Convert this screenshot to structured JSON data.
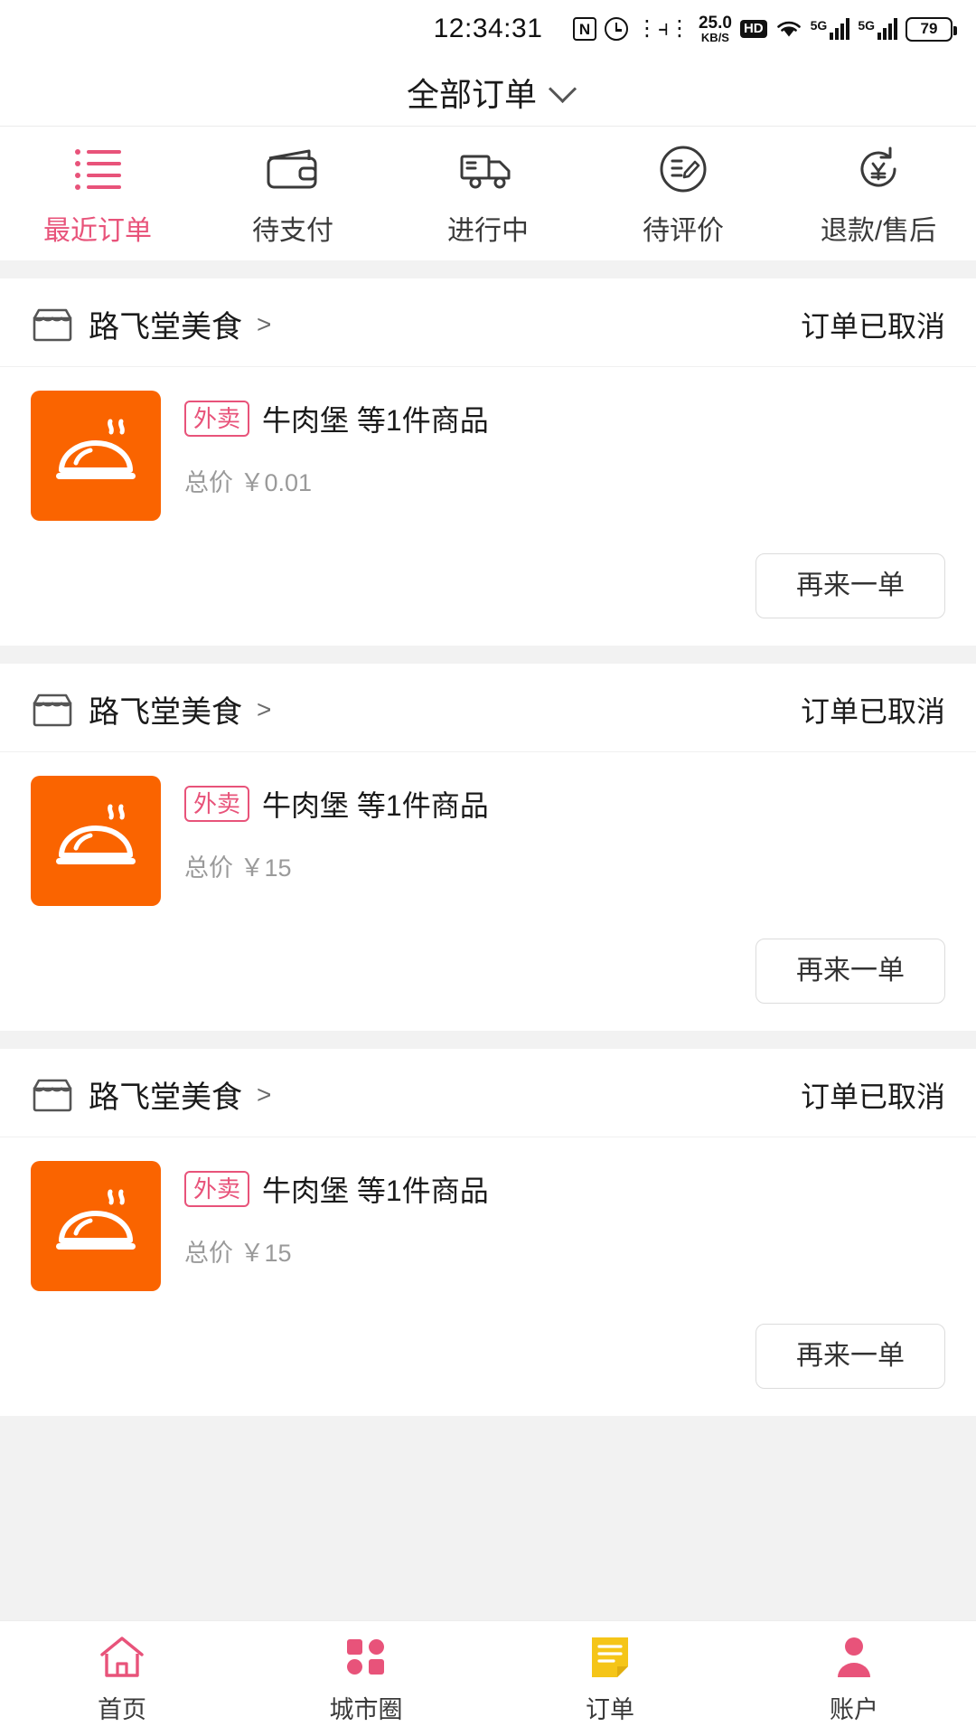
{
  "status_bar": {
    "time": "12:34:31",
    "nfc_label": "N",
    "net_speed_value": "25.0",
    "net_speed_unit": "KB/S",
    "hd_label": "HD",
    "sim1_label": "5G",
    "sim2_label": "5G",
    "battery_level": "79",
    "icons": [
      "nfc-icon",
      "alarm-icon",
      "vibrate-icon",
      "network-speed-icon",
      "hd-icon",
      "wifi-icon",
      "signal-icon",
      "signal-icon",
      "battery-icon"
    ]
  },
  "header": {
    "title": "全部订单",
    "chevron": "chevron-down-icon"
  },
  "tabs": [
    {
      "label": "最近订单",
      "icon": "list-icon",
      "active": true
    },
    {
      "label": "待支付",
      "icon": "wallet-icon",
      "active": false
    },
    {
      "label": "进行中",
      "icon": "truck-icon",
      "active": false
    },
    {
      "label": "待评价",
      "icon": "review-icon",
      "active": false
    },
    {
      "label": "退款/售后",
      "icon": "refund-icon",
      "active": false
    }
  ],
  "orders": [
    {
      "shop_name": "路飞堂美食",
      "shop_arrow": ">",
      "status": "订单已取消",
      "badge": "外卖",
      "goods": "牛肉堡 等1件商品",
      "total_label": "总价",
      "total_price": "￥0.01",
      "action": "再来一单",
      "thumb_icon": "food-cover-icon"
    },
    {
      "shop_name": "路飞堂美食",
      "shop_arrow": ">",
      "status": "订单已取消",
      "badge": "外卖",
      "goods": "牛肉堡 等1件商品",
      "total_label": "总价",
      "total_price": "￥15",
      "action": "再来一单",
      "thumb_icon": "food-cover-icon"
    },
    {
      "shop_name": "路飞堂美食",
      "shop_arrow": ">",
      "status": "订单已取消",
      "badge": "外卖",
      "goods": "牛肉堡 等1件商品",
      "total_label": "总价",
      "total_price": "￥15",
      "action": "再来一单",
      "thumb_icon": "food-cover-icon"
    }
  ],
  "bottom_nav": [
    {
      "label": "首页",
      "icon": "home-icon"
    },
    {
      "label": "城市圈",
      "icon": "city-circle-icon"
    },
    {
      "label": "订单",
      "icon": "order-icon"
    },
    {
      "label": "账户",
      "icon": "account-icon"
    }
  ],
  "colors": {
    "accent_pink": "#e8537a",
    "thumb_orange": "#fa6400",
    "order_icon_yellow": "#f5c518",
    "page_bg": "#f2f2f2"
  }
}
